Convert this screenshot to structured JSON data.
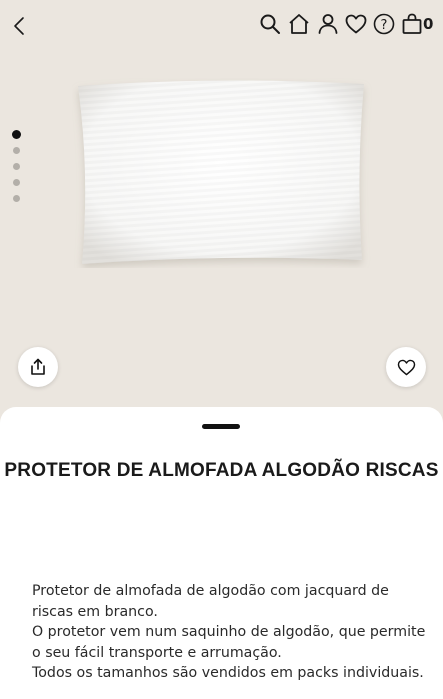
{
  "header": {
    "icons": [
      "back-icon",
      "search-icon",
      "home-icon",
      "user-icon",
      "heart-icon",
      "help-icon",
      "bag-icon"
    ],
    "help_glyph": "?",
    "bag_count": "0"
  },
  "gallery": {
    "image_count": 5,
    "active_index": 0
  },
  "product": {
    "title": "PROTETOR DE ALMOFADA ALGODÃO RISCAS",
    "description": [
      "Protetor de almofada de algodão com jacquard de riscas em branco.",
      "O protetor vem num saquinho de algodão, que permite o seu fácil transporte e arrumação.",
      "Todos os tamanhos são vendidos em packs individuais."
    ]
  },
  "colors": {
    "background": "#ebe6df",
    "sheet": "#ffffff",
    "text": "#1c1c1c"
  }
}
